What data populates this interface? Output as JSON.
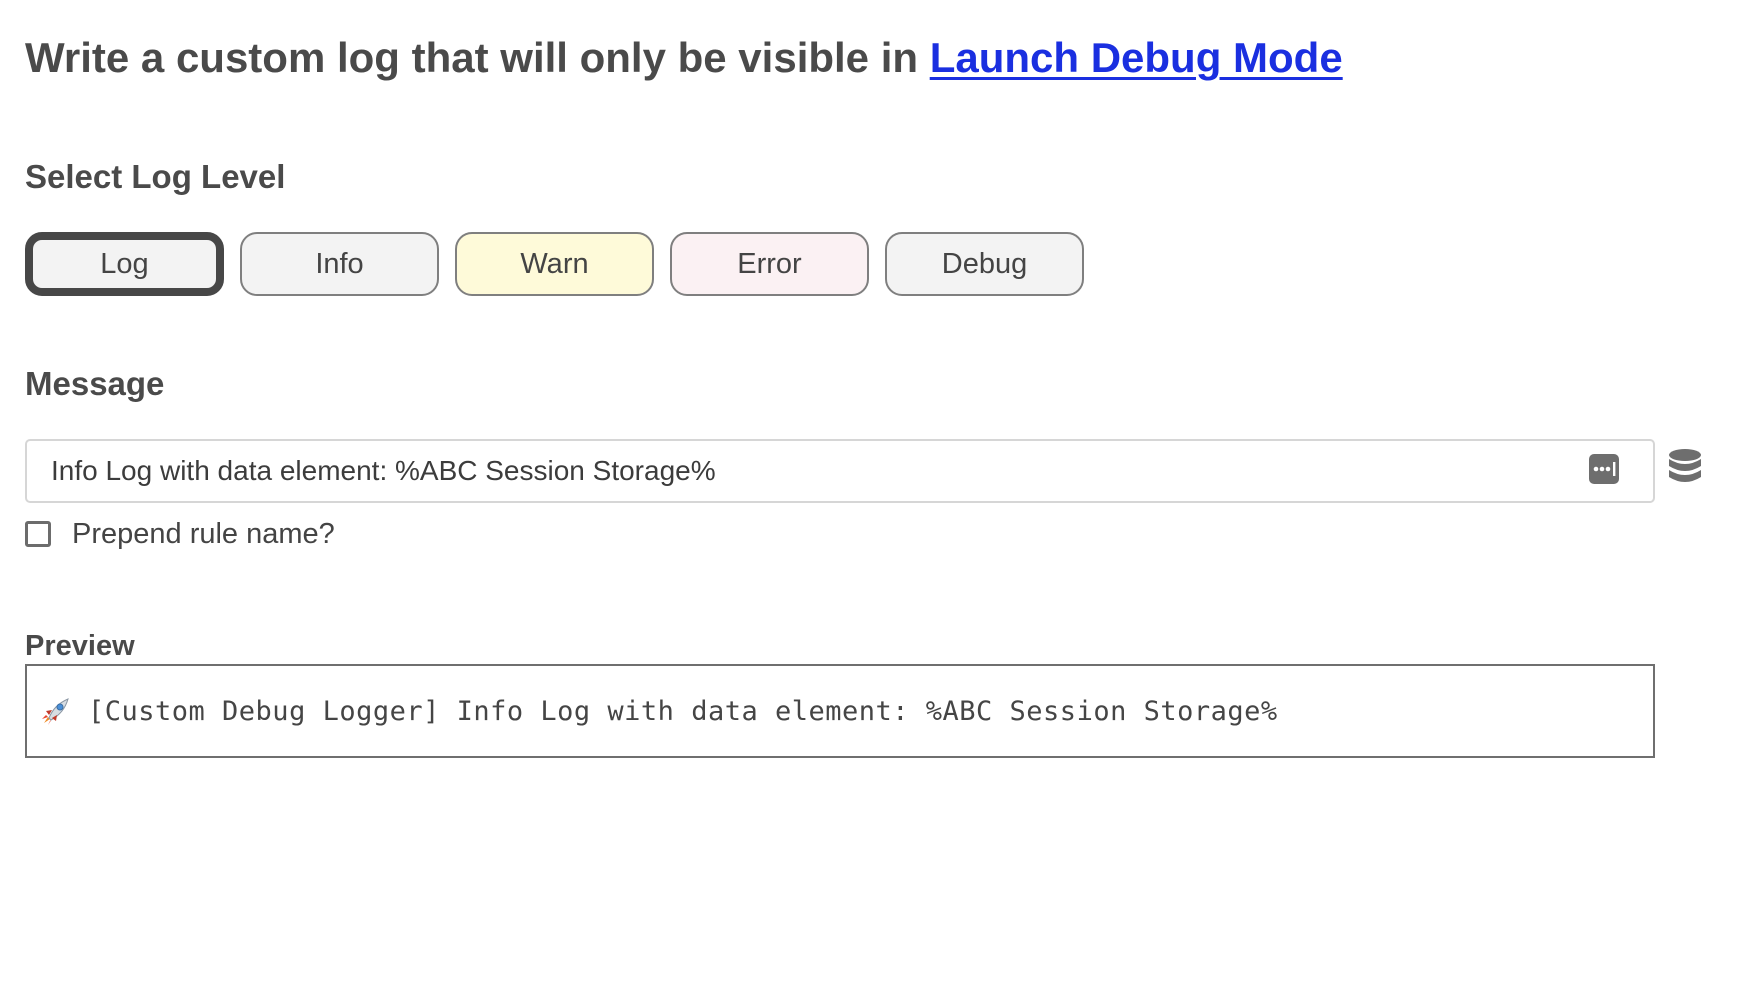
{
  "header": {
    "title_prefix": "Write a custom log that will only be visible in ",
    "link_label": "Launch Debug Mode"
  },
  "log_level": {
    "label": "Select Log Level",
    "selected": "Log",
    "options": [
      {
        "label": "Log",
        "color": "#f3f3f3"
      },
      {
        "label": "Info",
        "color": "#f3f3f3"
      },
      {
        "label": "Warn",
        "color": "#fefad9"
      },
      {
        "label": "Error",
        "color": "#fbf1f3"
      },
      {
        "label": "Debug",
        "color": "#f3f3f3"
      }
    ]
  },
  "message": {
    "label": "Message",
    "value": "Info Log with data element: %ABC Session Storage%",
    "dots_icon": "more-dots-icon",
    "data_element_icon": "database-icon"
  },
  "prepend": {
    "label": "Prepend rule name?",
    "checked": false
  },
  "preview": {
    "label": "Preview",
    "icon": "rocket-icon",
    "text": "[Custom Debug Logger] Info Log with data element: %ABC Session Storage%"
  },
  "colors": {
    "text": "#4a4a4a",
    "link": "#1a2fe0",
    "selected_border": "#474747"
  }
}
